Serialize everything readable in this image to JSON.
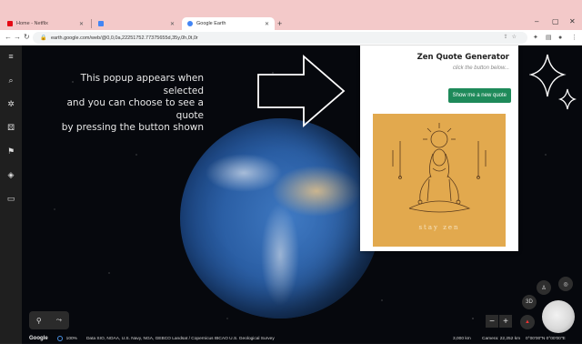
{
  "browser": {
    "tabs": [
      {
        "title": "Home - Netflix",
        "state": "inactive",
        "favicon_color": "#e50914"
      },
      {
        "title": "",
        "state": "inactive",
        "favicon_color": "#4285f4"
      },
      {
        "title": "Google Earth",
        "state": "active",
        "favicon_color": "#4285f4"
      }
    ],
    "new_tab_label": "+",
    "url": "earth.google.com/web/@0,0,0a,22251752.77375655d,35y,0h,0t,0r"
  },
  "sidebar": {
    "items": [
      {
        "name": "menu-icon",
        "glyph": "≡"
      },
      {
        "name": "search-icon",
        "glyph": "⌕"
      },
      {
        "name": "voyager-icon",
        "glyph": "✲"
      },
      {
        "name": "feeling-lucky-icon",
        "glyph": "⚄"
      },
      {
        "name": "projects-icon",
        "glyph": "⚑"
      },
      {
        "name": "layers-icon",
        "glyph": "◈"
      },
      {
        "name": "measure-icon",
        "glyph": "▭"
      }
    ]
  },
  "annotation": {
    "lines": [
      "This popup appears when selected",
      "and you can choose to see a quote",
      "by pressing the button shown"
    ]
  },
  "popup": {
    "title": "Zen Quote Generator",
    "hint": "click the button below...",
    "button_label": "Show me a new quote",
    "image_caption": "stay zen",
    "card_color": "#e2a94e",
    "button_color": "#1e8a5a"
  },
  "controls": {
    "view_3d_label": "3D",
    "zoom_out_label": "−",
    "zoom_in_label": "+"
  },
  "statusbar": {
    "logo": "Google",
    "zoom": "100%",
    "attribution": "Data SIO, NOAA, U.S. Navy, NGA, GEBCO  Landsat / Copernicus  IBCAO  U.S. Geological Survey",
    "scale": "3,000 km",
    "camera": "Camera: 22,252 km",
    "coords": "0°00'00\"N 0°00'00\"E"
  }
}
